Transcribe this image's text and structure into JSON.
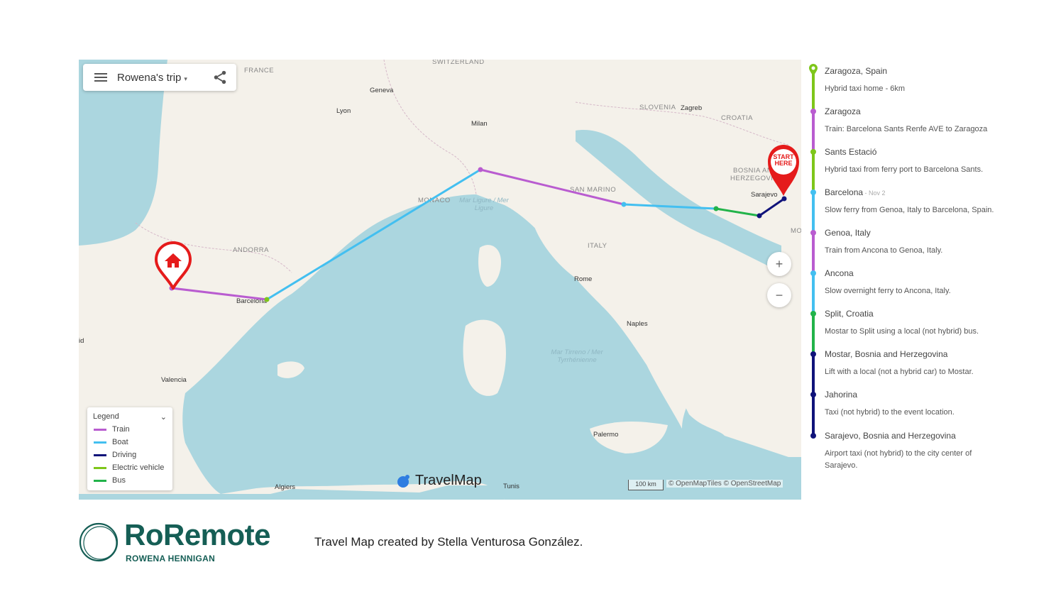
{
  "trip": {
    "title": "Rowena's trip"
  },
  "map": {
    "labels": {
      "countries": [
        "FRANCE",
        "SWITZERLAND",
        "SLOVENIA",
        "CROATIA",
        "BOSNIA AN",
        "HERZEGOVIN",
        "ANDORRA",
        "MONACO",
        "SAN MARINO",
        "ITALY",
        "MO"
      ],
      "cities": [
        "Geneva",
        "Lyon",
        "Milan",
        "Zagreb",
        "Sarajevo",
        "Barcelona",
        "Rome",
        "Naples",
        "Valencia",
        "Palermo",
        "Algiers",
        "Tunis",
        "id"
      ],
      "seas": [
        "Mar Ligure / Mer Ligure",
        "Mar Tirreno / Mer Tyrrhénienne"
      ]
    },
    "start_marker": "START HERE",
    "zoom_in": "+",
    "zoom_out": "−",
    "brand": "TravelMap",
    "scale": "100 km",
    "attribution": "© OpenMapTiles © OpenStreetMap"
  },
  "legend": {
    "title": "Legend",
    "items": [
      {
        "label": "Train",
        "color": "#b95cd0"
      },
      {
        "label": "Boat",
        "color": "#43bff0"
      },
      {
        "label": "Driving",
        "color": "#10137a"
      },
      {
        "label": "Electric vehicle",
        "color": "#7ec61a"
      },
      {
        "label": "Bus",
        "color": "#22b34a"
      }
    ]
  },
  "timeline": [
    {
      "name": "Zaragoza, Spain",
      "date": "",
      "desc": "Hybrid taxi home - 6km",
      "color": "#7ec61a"
    },
    {
      "name": "Zaragoza",
      "date": "",
      "desc": "Train: Barcelona Sants Renfe AVE to Zaragoza",
      "color": "#b95cd0"
    },
    {
      "name": "Sants Estació",
      "date": "",
      "desc": "Hybrid taxi from ferry port to Barcelona Sants.",
      "color": "#7ec61a"
    },
    {
      "name": "Barcelona",
      "date": " - Nov 2",
      "desc": "Slow ferry from Genoa, Italy to Barcelona, Spain.",
      "color": "#43bff0"
    },
    {
      "name": "Genoa, Italy",
      "date": "",
      "desc": "Train from Ancona to Genoa, Italy.",
      "color": "#b95cd0"
    },
    {
      "name": "Ancona",
      "date": "",
      "desc": "Slow overnight ferry to Ancona, Italy.",
      "color": "#43bff0"
    },
    {
      "name": "Split, Croatia",
      "date": "",
      "desc": "Mostar to Split using a local (not hybrid) bus.",
      "color": "#22b34a"
    },
    {
      "name": "Mostar, Bosnia and Herzegovina",
      "date": "",
      "desc": "Lift with a local (not a hybrid car) to Mostar.",
      "color": "#10137a"
    },
    {
      "name": "Jahorina",
      "date": "",
      "desc": "Taxi (not hybrid) to the event location.",
      "color": "#10137a"
    },
    {
      "name": "Sarajevo, Bosnia and Herzegovina",
      "date": "",
      "desc": "Airport taxi (not hybrid) to the city center of Sarajevo.",
      "color": "#10137a"
    }
  ],
  "footer": {
    "logo": "RoRemote",
    "logo_sub": "ROWENA HENNIGAN",
    "credit": "Travel Map created by Stella Venturosa González."
  }
}
